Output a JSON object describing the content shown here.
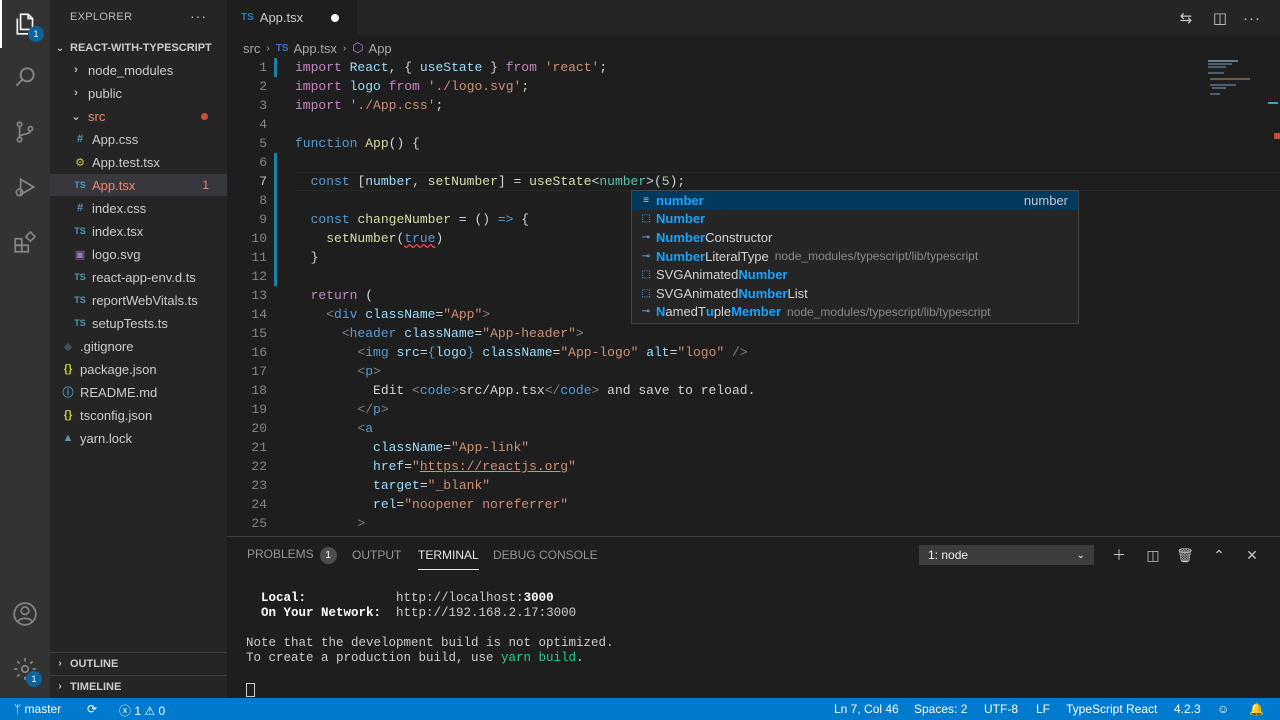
{
  "sidebar": {
    "header": "EXPLORER",
    "more": "···",
    "project": "REACT-WITH-TYPESCRIPT",
    "items": [
      {
        "label": "node_modules",
        "icon": ">"
      },
      {
        "label": "public",
        "icon": ">"
      },
      {
        "label": "src",
        "icon": "v"
      },
      {
        "label": "App.css",
        "icon": "#"
      },
      {
        "label": "App.test.tsx",
        "icon": "⚙"
      },
      {
        "label": "App.tsx",
        "icon": "TS",
        "count": "1"
      },
      {
        "label": "index.css",
        "icon": "#"
      },
      {
        "label": "index.tsx",
        "icon": "TS"
      },
      {
        "label": "logo.svg",
        "icon": "▣"
      },
      {
        "label": "react-app-env.d.ts",
        "icon": "TS"
      },
      {
        "label": "reportWebVitals.ts",
        "icon": "TS"
      },
      {
        "label": "setupTests.ts",
        "icon": "TS"
      },
      {
        "label": ".gitignore",
        "icon": "◆"
      },
      {
        "label": "package.json",
        "icon": "{}"
      },
      {
        "label": "README.md",
        "icon": "ⓘ"
      },
      {
        "label": "tsconfig.json",
        "icon": "{}"
      },
      {
        "label": "yarn.lock",
        "icon": "▲"
      }
    ],
    "outline": "OUTLINE",
    "timeline": "TIMELINE"
  },
  "activity_badges": {
    "scm": "1",
    "settings": "1"
  },
  "tab": {
    "ts": "TS",
    "label": "App.tsx"
  },
  "breadcrumb": {
    "folder": "src",
    "file_ts": "TS",
    "file": "App.tsx",
    "symbol": "App"
  },
  "lines": [
    "1",
    "2",
    "3",
    "4",
    "5",
    "6",
    "7",
    "8",
    "9",
    "10",
    "11",
    "12",
    "13",
    "14",
    "15",
    "16",
    "17",
    "18",
    "19",
    "20",
    "21",
    "22",
    "23",
    "24",
    "25"
  ],
  "suggest": [
    {
      "icon": "≡",
      "pre": "",
      "hl": "number",
      "post": "",
      "detail": "",
      "right": "number"
    },
    {
      "icon": "⬚",
      "pre": "",
      "hl": "Number",
      "post": "",
      "detail": "",
      "right": ""
    },
    {
      "icon": "⊸",
      "pre": "",
      "hl": "Number",
      "post": "Constructor",
      "detail": "",
      "right": ""
    },
    {
      "icon": "⊸",
      "pre": "",
      "hl": "Number",
      "post": "LiteralType",
      "detail": "node_modules/typescript/lib/typescript",
      "right": ""
    },
    {
      "icon": "⬚",
      "pre": "SVGAnimated",
      "hl": "Number",
      "post": "",
      "detail": "",
      "right": ""
    },
    {
      "icon": "⬚",
      "pre": "SVGAnimated",
      "hl": "Number",
      "post": "List",
      "detail": "",
      "right": ""
    },
    {
      "icon": "⊸",
      "pre": "",
      "hl": "N",
      "post": "amedT",
      "hl2": "u",
      "post2": "ple",
      "hl3": "Member",
      "detail": "node_modules/typescript/lib/typescript",
      "right": ""
    }
  ],
  "panel": {
    "tabs": {
      "problems": "PROBLEMS",
      "problems_count": "1",
      "output": "OUTPUT",
      "terminal": "TERMINAL",
      "debug": "DEBUG CONSOLE"
    },
    "terminal_select": "1: node",
    "terminal": {
      "local_label": "  Local:",
      "local_url_pre": "http://localhost:",
      "local_port": "3000",
      "network_label": "  On Your Network:",
      "network_url": "http://192.168.2.17:3000",
      "note1": "Note that the development build is not optimized.",
      "note2_pre": "To create a production build, use ",
      "note2_cmd": "yarn build",
      "note2_post": "."
    }
  },
  "status": {
    "branch": "master",
    "errors": "1",
    "warnings": "0",
    "position": "Ln 7, Col 46",
    "spaces": "Spaces: 2",
    "encoding": "UTF-8",
    "eol": "LF",
    "language": "TypeScript React",
    "version": "4.2.3"
  },
  "colors": {
    "accent": "#007acc",
    "activity": "#333333",
    "sidebar": "#252526",
    "editor": "#1e1e1e"
  }
}
